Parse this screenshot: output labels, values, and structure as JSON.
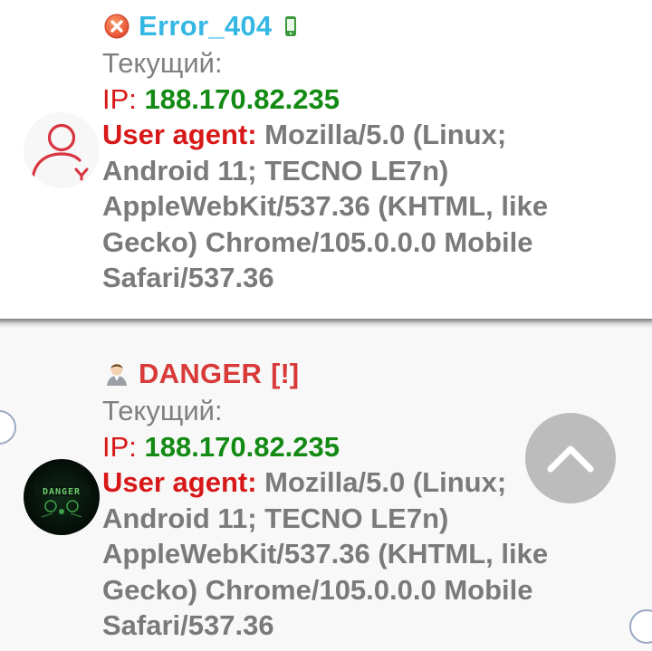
{
  "entries": [
    {
      "name": "Error_404",
      "status": "Текущий:",
      "ip_label": "IP:",
      "ip_value": "188.170.82.235",
      "ua_label": "User agent:",
      "ua_lines": [
        "Mozilla/5.0 (Linux;",
        "Android 11; TECNO LE7n)",
        "AppleWebKit/537.36 (KHTML, like",
        "Gecko) Chrome/105.0.0.0 Mobile",
        "Safari/537.36"
      ],
      "name_color": "#35b7e4",
      "icons": [
        "error-x-icon",
        "mobile-phone-icon",
        "user-avatar-outline-icon"
      ]
    },
    {
      "name": "DANGER",
      "badge": "[!]",
      "status": "Текущий:",
      "ip_label": "IP:",
      "ip_value": "188.170.82.235",
      "ua_label": "User agent:",
      "ua_lines": [
        "Mozilla/5.0 (Linux;",
        "Android 11; TECNO LE7n)",
        "AppleWebKit/537.36 (KHTML, like",
        "Gecko) Chrome/105.0.0.0 Mobile",
        "Safari/537.36"
      ],
      "name_color": "#d83a3a",
      "icons": [
        "person-emoji-icon",
        "danger-avatar-image"
      ]
    }
  ],
  "colors": {
    "ip_label": "#d81818",
    "ip_value": "#138a13",
    "ua_label": "#d81818",
    "body_text": "#7a7a7a"
  },
  "scroll_button_icon": "chevron-up-icon"
}
